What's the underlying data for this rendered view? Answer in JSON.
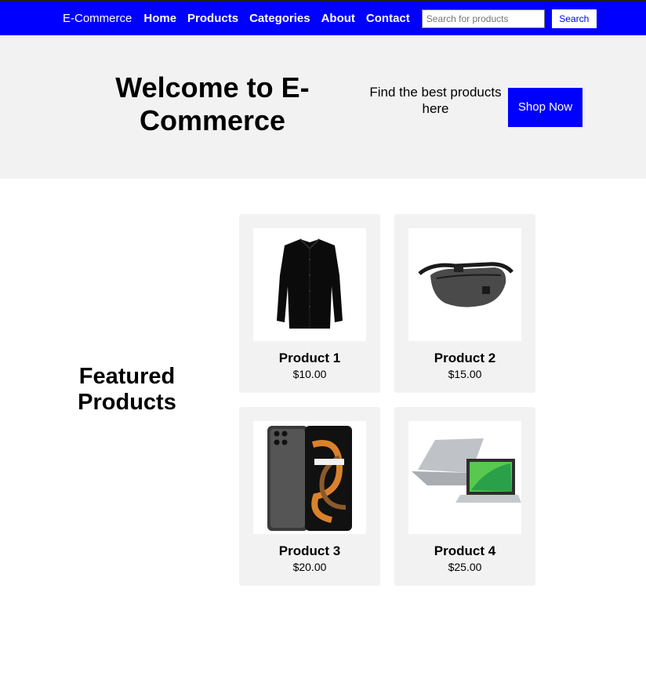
{
  "nav": {
    "brand": "E-Commerce",
    "links": [
      "Home",
      "Products",
      "Categories",
      "About",
      "Contact"
    ],
    "search_placeholder": "Search for products",
    "search_button": "Search",
    "color": "#0000ff"
  },
  "hero": {
    "title": "Welcome to E-Commerce",
    "subtitle": "Find the best products here",
    "button": "Shop Now"
  },
  "featured": {
    "title": "Featured Products",
    "products": [
      {
        "name": "Product 1",
        "price": "$10.00",
        "image": "shirt-image"
      },
      {
        "name": "Product 2",
        "price": "$15.00",
        "image": "waist-bag-image"
      },
      {
        "name": "Product 3",
        "price": "$20.00",
        "image": "smartphone-image"
      },
      {
        "name": "Product 4",
        "price": "$25.00",
        "image": "laptops-image"
      }
    ]
  }
}
